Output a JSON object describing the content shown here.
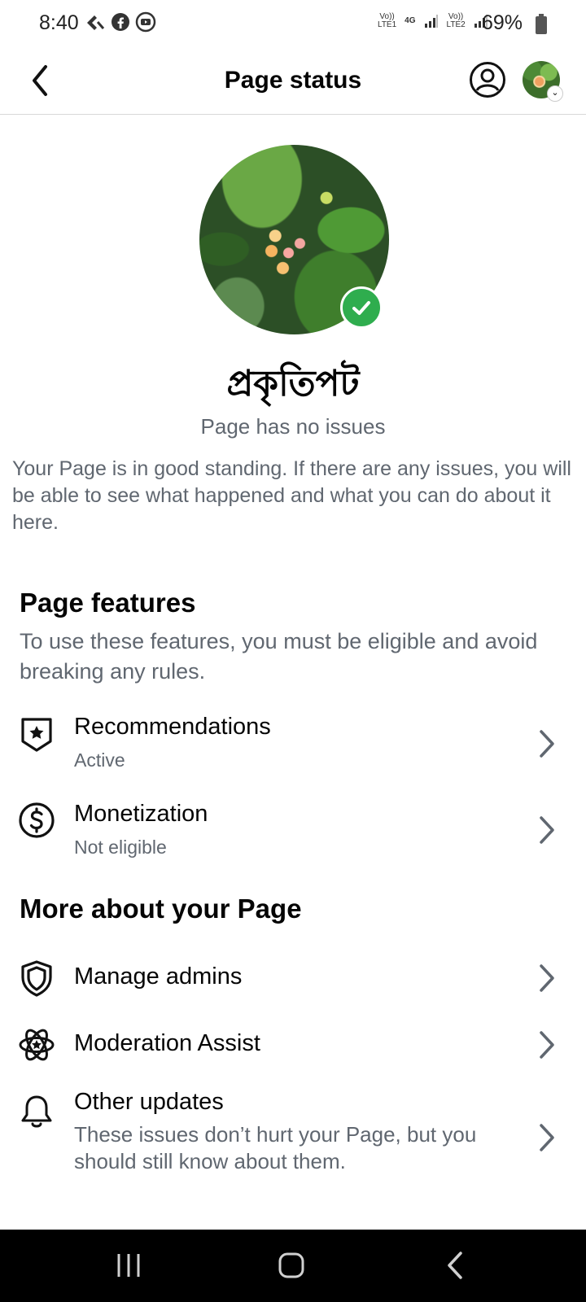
{
  "status_bar": {
    "time": "8:40",
    "battery": "69%",
    "network": {
      "sim1_label": "Vo)) LTE1",
      "sim1_type": "4G",
      "sim2_label": "Vo)) LTE2"
    }
  },
  "header": {
    "title": "Page status"
  },
  "profile": {
    "name": "প্রকৃতিপট",
    "status": "Page has no issues",
    "description": "Your Page is in good standing. If there are any issues, you will be able to see what happened and what you can do about it here."
  },
  "page_features": {
    "title": "Page features",
    "subtitle": "To use these features, you must be eligible and avoid breaking any rules.",
    "items": [
      {
        "label": "Recommendations",
        "status": "Active",
        "icon": "shield-star-icon"
      },
      {
        "label": "Monetization",
        "status": "Not eligible",
        "icon": "dollar-circle-icon"
      }
    ]
  },
  "more_about": {
    "title": "More about your Page",
    "items": [
      {
        "label": "Manage admins",
        "icon": "shield-icon"
      },
      {
        "label": "Moderation Assist",
        "icon": "moderation-atom-icon"
      },
      {
        "label": "Other updates",
        "description": "These issues don’t hurt your Page, but you should still know about them.",
        "icon": "bell-icon"
      }
    ]
  },
  "colors": {
    "verified_green": "#2fad4e",
    "secondary_text": "#606770",
    "primary_text": "#050505"
  }
}
